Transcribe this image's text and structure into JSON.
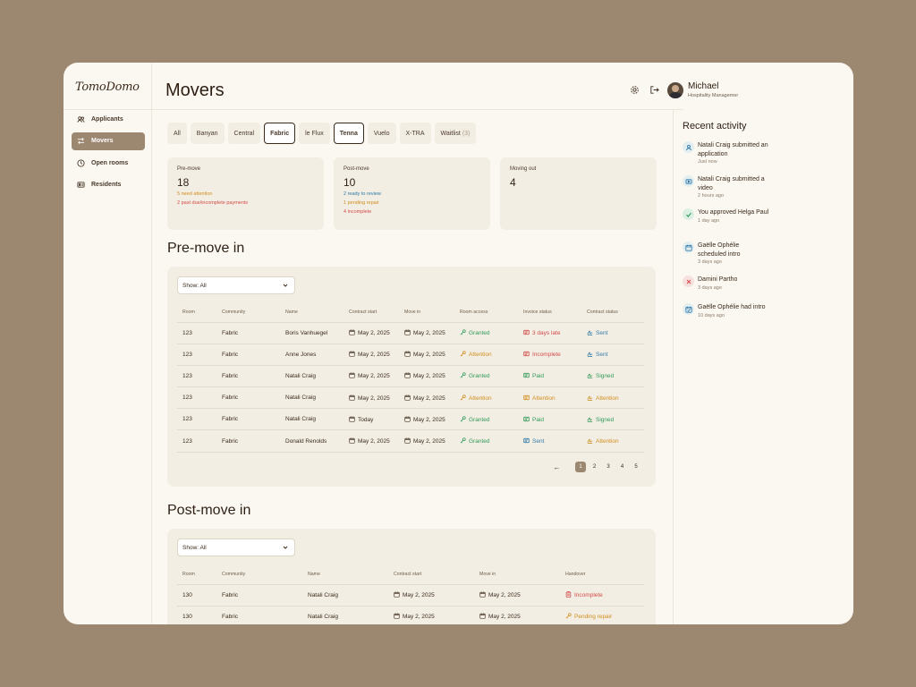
{
  "logo": "TomoDomo",
  "nav": [
    {
      "label": "Applicants",
      "icon": "users-icon"
    },
    {
      "label": "Movers",
      "icon": "swap-arrows-icon",
      "active": true
    },
    {
      "label": "Open rooms",
      "icon": "door-icon"
    },
    {
      "label": "Residents",
      "icon": "id-card-icon"
    }
  ],
  "page_title": "Movers",
  "user": {
    "name": "Michael",
    "role": "Hospitality Managemer"
  },
  "filters": [
    {
      "label": "All"
    },
    {
      "label": "Banyan"
    },
    {
      "label": "Central"
    },
    {
      "label": "Fabric",
      "selected": true
    },
    {
      "label": "le Flux"
    },
    {
      "label": "Tenna",
      "selected": true
    },
    {
      "label": "Vuelo"
    },
    {
      "label": "X-TRA"
    },
    {
      "label": "Waitlist",
      "count": "(3)"
    }
  ],
  "stats": {
    "pre_move": {
      "label": "Pre-move",
      "value": "18",
      "notes": [
        "5 need attention",
        "2 past due/incomplete payments"
      ]
    },
    "post_move": {
      "label": "Post-move",
      "value": "10",
      "notes": [
        "2 ready to review",
        "1 pending repair",
        "4 incomplete"
      ]
    },
    "moving_out": {
      "label": "Moving out",
      "value": "4"
    }
  },
  "pre_move_in": {
    "title": "Pre-move in",
    "show": "Show: All",
    "headers": [
      "Room",
      "Community",
      "Name",
      "Contract start",
      "Move in",
      "Room access",
      "Invoice status",
      "Contract status"
    ],
    "rows": [
      {
        "room": "123",
        "community": "Fabric",
        "name": "Boris Vanhuegel",
        "contract_start": "May 2, 2025",
        "move_in": "May 2, 2025",
        "access": "Granted",
        "invoice": "3 days late",
        "contract": "Sent"
      },
      {
        "room": "123",
        "community": "Fabric",
        "name": "Anne Jones",
        "contract_start": "May 2, 2025",
        "move_in": "May 2, 2025",
        "access": "Attention",
        "invoice": "Incomplete",
        "contract": "Sent"
      },
      {
        "room": "123",
        "community": "Fabric",
        "name": "Natali Craig",
        "contract_start": "May 2, 2025",
        "move_in": "May 2, 2025",
        "access": "Granted",
        "invoice": "Paid",
        "contract": "Signed"
      },
      {
        "room": "123",
        "community": "Fabric",
        "name": "Natali Craig",
        "contract_start": "May 2, 2025",
        "move_in": "May 2, 2025",
        "access": "Attention",
        "invoice": "Attention",
        "contract": "Attention"
      },
      {
        "room": "123",
        "community": "Fabric",
        "name": "Natali Craig",
        "contract_start": "Today",
        "move_in": "May 2, 2025",
        "access": "Granted",
        "invoice": "Paid",
        "contract": "Signed"
      },
      {
        "room": "123",
        "community": "Fabric",
        "name": "Donald Renolds",
        "contract_start": "May 2, 2025",
        "move_in": "May 2, 2025",
        "access": "Granted",
        "invoice": "Sent",
        "contract": "Attention"
      }
    ],
    "pagination": {
      "prev": "←",
      "pages": [
        "1",
        "2",
        "3",
        "4",
        "5"
      ],
      "current": "1",
      "next": "→"
    }
  },
  "post_move_in": {
    "title": "Post-move in",
    "show": "Show: All",
    "headers": [
      "Room",
      "Community",
      "Name",
      "Contract start",
      "Move in",
      "Handover"
    ],
    "rows": [
      {
        "room": "130",
        "community": "Fabric",
        "name": "Natali Craig",
        "contract_start": "May 2, 2025",
        "move_in": "May 2, 2025",
        "handover": "Incomplete"
      },
      {
        "room": "130",
        "community": "Fabric",
        "name": "Natali Craig",
        "contract_start": "May 2, 2025",
        "move_in": "May 2, 2025",
        "handover": "Pending repair"
      }
    ]
  },
  "activity": {
    "title": "Recent activity",
    "items": [
      {
        "text": "Natali Craig submitted an application",
        "time": "Just now",
        "icon": "user-icon"
      },
      {
        "text": "Natali Craig submitted a video",
        "time": "2 hours ago",
        "icon": "video-icon"
      },
      {
        "text": "You approved Helga Paul",
        "time": "1 day ago",
        "icon": "check-icon"
      },
      {
        "text": "Gaëlle Ophélie scheduled intro",
        "time": "3 days ago",
        "icon": "calendar-icon"
      },
      {
        "text": "Damini Partho",
        "time": "3 days ago",
        "icon": "x-icon"
      },
      {
        "text": "Gaëlle Ophélie had intro",
        "time": "10 days ago",
        "icon": "calendar-check-icon"
      }
    ]
  },
  "colors": {
    "accent": "#9c8770",
    "granted": "#2f9a5a",
    "attention": "#d08d1e",
    "late": "#d24a4a",
    "sent": "#2f79a8"
  }
}
